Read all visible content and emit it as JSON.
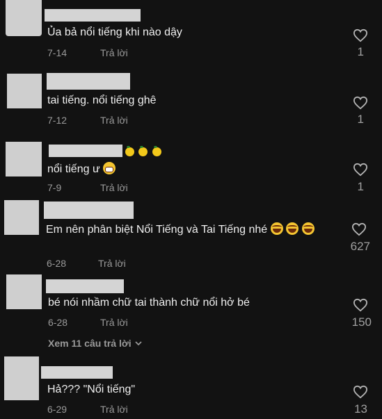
{
  "comments": [
    {
      "text": "Ủa bả nổi tiếng khi nào dậy",
      "date": "7-14",
      "reply_label": "Trả lời",
      "likes": "1"
    },
    {
      "text": "tai tiếng. nổi tiếng ghê",
      "date": "7-12",
      "reply_label": "Trả lời",
      "likes": "1"
    },
    {
      "text": "nổi tiếng ư",
      "date": "7-9",
      "reply_label": "Trả lời",
      "likes": "1",
      "name_emoji": "lemon-emoji",
      "text_emoji": "grimacing-face-emoji"
    },
    {
      "text": "Em nên phân biệt Nổi Tiếng và Tai Tiếng nhé",
      "date": "6-28",
      "reply_label": "Trả lời",
      "likes": "627",
      "text_emoji": "tears-of-joy-emoji"
    },
    {
      "text": "bé nói nhầm chữ tai thành chữ nổi hở bé",
      "date": "6-28",
      "reply_label": "Trả lời",
      "likes": "150"
    },
    {
      "text": "Hả??? \"Nổi tiếng\"",
      "date": "6-29",
      "reply_label": "Trả lời",
      "likes": "13"
    }
  ],
  "view_replies": "Xem 11 câu trả lời",
  "colors": {
    "background": "#121212",
    "text": "#f0f0f0",
    "muted": "#9a9a9a"
  }
}
